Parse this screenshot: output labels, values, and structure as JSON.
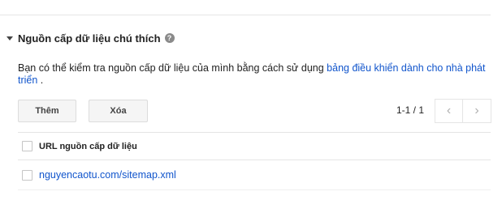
{
  "section": {
    "title": "Nguồn cấp dữ liệu chú thích",
    "help_glyph": "?",
    "description_text": "Bạn có thể kiểm tra nguồn cấp dữ liệu của mình bằng cách sử dụng ",
    "description_link": "bảng điều khiển dành cho nhà phát triển",
    "description_suffix": " ."
  },
  "toolbar": {
    "add_label": "Thêm",
    "delete_label": "Xóa"
  },
  "pagination": {
    "count": "1-1 / 1",
    "prev_glyph": "‹",
    "next_glyph": "›"
  },
  "table": {
    "column_header": "URL nguồn cấp dữ liệu",
    "rows": [
      {
        "url": "nguyencaotu.com/sitemap.xml"
      }
    ]
  },
  "icons": {
    "collapse": "triangle-down-icon",
    "help": "help-circle-icon",
    "prev": "chevron-left-icon",
    "next": "chevron-right-icon"
  },
  "colors": {
    "link": "#1155cc",
    "button_bg": "#f5f5f5",
    "divider": "#e5e5e5"
  }
}
